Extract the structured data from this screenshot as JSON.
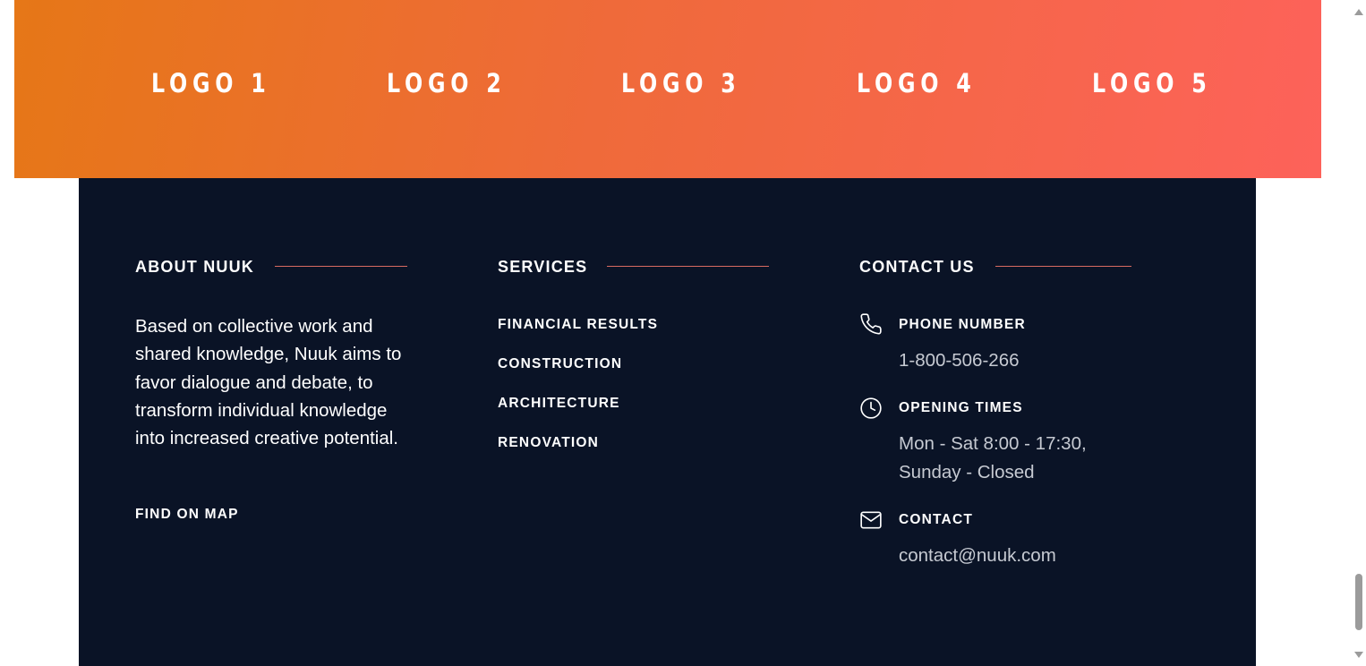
{
  "logos": [
    "LOGO 1",
    "LOGO 2",
    "LOGO 3",
    "LOGO 4",
    "LOGO 5"
  ],
  "about": {
    "title": "ABOUT NUUK",
    "text": "Based on collective work and shared knowledge, Nuuk aims to favor dialogue and debate, to transform individual knowledge into increased creative potential.",
    "map_link": "FIND ON MAP"
  },
  "services": {
    "title": "SERVICES",
    "items": [
      "FINANCIAL RESULTS",
      "CONSTRUCTION",
      "ARCHITECTURE",
      "RENOVATION"
    ]
  },
  "contact": {
    "title": "CONTACT US",
    "phone_label": "PHONE NUMBER",
    "phone_value": "1-800-506-266",
    "hours_label": "OPENING TIMES",
    "hours_line1": "Mon - Sat 8:00 - 17:30,",
    "hours_line2": "Sunday - Closed",
    "email_label": "CONTACT",
    "email_value": "contact@nuuk.com",
    "icons": [
      "phone-icon",
      "clock-icon",
      "mail-icon"
    ]
  },
  "colors": {
    "gradient_start": "#e67717",
    "gradient_end": "#fd625a",
    "footer_bg": "#0a1326",
    "accent_line": "#d76a62"
  }
}
